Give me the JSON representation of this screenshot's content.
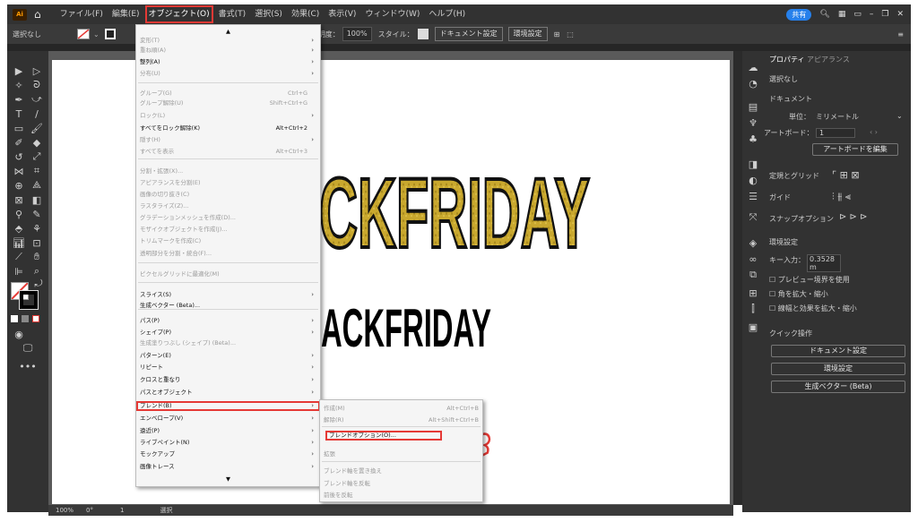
{
  "menubar": {
    "app_icon": "Ai",
    "home_icon": "home-icon",
    "menus": [
      "ファイル(F)",
      "編集(E)",
      "オブジェクト(O)",
      "書式(T)",
      "選択(S)",
      "効果(C)",
      "表示(V)",
      "ウィンドウ(W)",
      "ヘルプ(H)"
    ],
    "share_label": "共有",
    "search_icon": "search-icon"
  },
  "control_bar": {
    "selection": "選択なし",
    "opacity_label": "不透明度：",
    "opacity_value": "100%",
    "style_label": "スタイル：",
    "document_settings": "ドキュメント設定",
    "preferences": "環境設定"
  },
  "canvas": {
    "text_yellow": "CKFRIDAY",
    "text_black": "ACKFRIDAY",
    "accent_yellow": "#c9a82e",
    "accent_red": "#e53935"
  },
  "object_menu": {
    "items": [
      {
        "label": "変形(T)",
        "shortcut": "",
        "arrow": true,
        "disabled": true
      },
      {
        "label": "重ね順(A)",
        "shortcut": "",
        "arrow": true,
        "disabled": true
      },
      {
        "label": "整列(A)",
        "shortcut": "",
        "arrow": true,
        "disabled": false
      },
      {
        "label": "分布(U)",
        "shortcut": "",
        "arrow": true,
        "disabled": true
      },
      {
        "label": "グループ(G)",
        "shortcut": "Ctrl+G",
        "arrow": false,
        "disabled": true
      },
      {
        "label": "グループ解除(U)",
        "shortcut": "Shift+Ctrl+G",
        "arrow": false,
        "disabled": true
      },
      {
        "label": "ロック(L)",
        "shortcut": "",
        "arrow": true,
        "disabled": true
      },
      {
        "label": "すべてをロック解除(K)",
        "shortcut": "Alt+Ctrl+2",
        "arrow": false,
        "disabled": false
      },
      {
        "label": "隠す(H)",
        "shortcut": "",
        "arrow": true,
        "disabled": true
      },
      {
        "label": "すべてを表示",
        "shortcut": "Alt+Ctrl+3",
        "arrow": false,
        "disabled": true
      },
      {
        "label": "分割・拡張(X)...",
        "shortcut": "",
        "arrow": false,
        "disabled": true
      },
      {
        "label": "アピアランスを分割(E)",
        "shortcut": "",
        "arrow": false,
        "disabled": true
      },
      {
        "label": "画像の切り抜き(C)",
        "shortcut": "",
        "arrow": false,
        "disabled": true
      },
      {
        "label": "ラスタライズ(Z)...",
        "shortcut": "",
        "arrow": false,
        "disabled": true
      },
      {
        "label": "グラデーションメッシュを作成(D)...",
        "shortcut": "",
        "arrow": false,
        "disabled": true
      },
      {
        "label": "モザイクオブジェクトを作成(J)...",
        "shortcut": "",
        "arrow": false,
        "disabled": true
      },
      {
        "label": "トリムマークを作成(C)",
        "shortcut": "",
        "arrow": false,
        "disabled": true
      },
      {
        "label": "透明部分を分割・統合(F)...",
        "shortcut": "",
        "arrow": false,
        "disabled": true
      },
      {
        "label": "ピクセルグリッドに最適化(M)",
        "shortcut": "",
        "arrow": false,
        "disabled": true
      },
      {
        "label": "スライス(S)",
        "shortcut": "",
        "arrow": true,
        "disabled": false
      },
      {
        "label": "生成ベクター (Beta)...",
        "shortcut": "",
        "arrow": false,
        "disabled": false
      },
      {
        "label": "パス(P)",
        "shortcut": "",
        "arrow": true,
        "disabled": false
      },
      {
        "label": "シェイプ(P)",
        "shortcut": "",
        "arrow": true,
        "disabled": false
      },
      {
        "label": "生成塗りつぶし (シェイプ) (Beta)...",
        "shortcut": "",
        "arrow": false,
        "disabled": true
      },
      {
        "label": "パターン(E)",
        "shortcut": "",
        "arrow": true,
        "disabled": false
      },
      {
        "label": "リピート",
        "shortcut": "",
        "arrow": true,
        "disabled": false
      },
      {
        "label": "クロスと重なり",
        "shortcut": "",
        "arrow": true,
        "disabled": false
      },
      {
        "label": "パスとオブジェクト",
        "shortcut": "",
        "arrow": true,
        "disabled": false
      },
      {
        "label": "ブレンド(B)",
        "shortcut": "",
        "arrow": true,
        "disabled": false
      },
      {
        "label": "エンベロープ(V)",
        "shortcut": "",
        "arrow": true,
        "disabled": false
      },
      {
        "label": "遠近(P)",
        "shortcut": "",
        "arrow": true,
        "disabled": false
      },
      {
        "label": "ライブペイント(N)",
        "shortcut": "",
        "arrow": true,
        "disabled": false
      },
      {
        "label": "モックアップ",
        "shortcut": "",
        "arrow": true,
        "disabled": false
      },
      {
        "label": "画像トレース",
        "shortcut": "",
        "arrow": true,
        "disabled": false
      }
    ]
  },
  "blend_submenu": {
    "items": [
      {
        "label": "作成(M)",
        "shortcut": "Alt+Ctrl+B",
        "disabled": true
      },
      {
        "label": "解除(R)",
        "shortcut": "Alt+Shift+Ctrl+B",
        "disabled": true
      },
      {
        "label": "ブレンドオプション(O)...",
        "shortcut": "",
        "disabled": false
      },
      {
        "label": "拡張",
        "shortcut": "",
        "disabled": true
      },
      {
        "label": "ブレンド軸を置き換え",
        "shortcut": "",
        "disabled": true
      },
      {
        "label": "ブレンド軸を反転",
        "shortcut": "",
        "disabled": true
      },
      {
        "label": "前後を反転",
        "shortcut": "",
        "disabled": true
      }
    ]
  },
  "properties_panel": {
    "tab_properties": "プロパティ",
    "tab_appearance": "アピアランス",
    "no_selection": "選択なし",
    "document_heading": "ドキュメント",
    "unit_label": "単位：",
    "unit_value": "ミリメートル",
    "artboard_label": "アートボード：",
    "artboard_value": "1",
    "edit_artboard": "アートボードを編集",
    "rulers_grids": "定規とグリッド",
    "guides": "ガイド",
    "snap_options": "スナップオプション",
    "preferences_heading": "環境設定",
    "key_increment_label": "キー入力：",
    "key_increment_value": "0.3528 m",
    "preview_bounds": "プレビュー境界を使用",
    "scale_corners": "角を拡大・縮小",
    "scale_strokes": "線幅と効果を拡大・縮小",
    "quick_actions": "クイック操作",
    "document_settings_btn": "ドキュメント設定",
    "preferences_btn": "環境設定",
    "generative_vector_btn": "生成ベクター (Beta)"
  },
  "status_bar": {
    "zoom": "100%",
    "rotation": "0°",
    "artboard_num": "1",
    "tool": "選択"
  }
}
